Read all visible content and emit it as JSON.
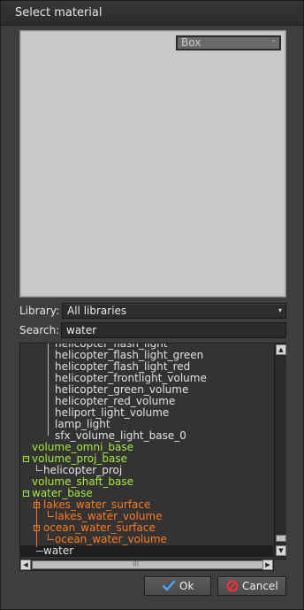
{
  "window": {
    "title": "Select material"
  },
  "preview": {
    "shape_value": "Box",
    "shape_button": "-"
  },
  "library": {
    "label": "Library:",
    "value": "All libraries",
    "arrow": "▾"
  },
  "search": {
    "label": "Search:",
    "value": "water"
  },
  "tree": {
    "rows": [
      {
        "label": "helicopter_flash_light",
        "color": "white"
      },
      {
        "label": "helicopter_flash_light_green",
        "color": "white"
      },
      {
        "label": "helicopter_flash_light_red",
        "color": "white"
      },
      {
        "label": "helicopter_frontlight_volume",
        "color": "white"
      },
      {
        "label": "helicopter_green_volume",
        "color": "white"
      },
      {
        "label": "helicopter_red_volume",
        "color": "white"
      },
      {
        "label": "heliport_light_volume",
        "color": "white"
      },
      {
        "label": "lamp_light",
        "color": "white"
      },
      {
        "label": "sfx_volume_light_base_0",
        "color": "white"
      },
      {
        "label": "volume_omni_base",
        "color": "green"
      },
      {
        "label": "volume_proj_base",
        "color": "green",
        "expander": "−"
      },
      {
        "label": "helicopter_proj",
        "color": "white"
      },
      {
        "label": "volume_shaft_base",
        "color": "green"
      },
      {
        "label": "water_base",
        "color": "green",
        "expander": "−"
      },
      {
        "label": "lakes_water_surface",
        "color": "orange",
        "expander": "−"
      },
      {
        "label": "lakes_water_volume",
        "color": "orange"
      },
      {
        "label": "ocean_water_surface",
        "color": "orange",
        "expander": "−"
      },
      {
        "label": "ocean_water_volume",
        "color": "orange"
      },
      {
        "label": "water",
        "color": "white",
        "selected": true
      }
    ]
  },
  "scrollbars": {
    "up": "▲",
    "down": "▼",
    "left": "◀",
    "right": "▶",
    "grip": "|||"
  },
  "buttons": {
    "ok": "Ok",
    "cancel": "Cancel"
  },
  "colors": {
    "white_text": "#e2e2e2",
    "green_text": "#a8ea3c",
    "orange_text": "#ff7a1e",
    "ok_icon": "#4aa8ff",
    "cancel_icon": "#ff3030"
  }
}
